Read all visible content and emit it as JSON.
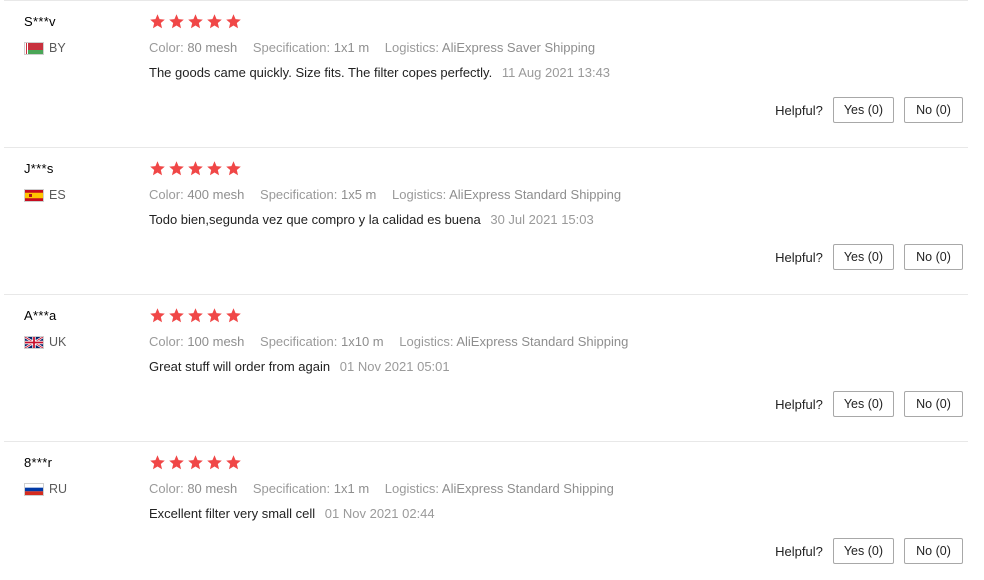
{
  "labels": {
    "color": "Color:",
    "specification": "Specification:",
    "logistics": "Logistics:",
    "helpful": "Helpful?"
  },
  "colors": {
    "star": "#f04747",
    "separator": "#e8e8e8"
  },
  "reviews": [
    {
      "user": "S***v",
      "country": "BY",
      "flag_icon": "belarus-flag-icon",
      "rating": 5,
      "color": "80 mesh",
      "specification": "1x1 m",
      "logistics": "AliExpress Saver Shipping",
      "text": "The goods came quickly. Size fits. The filter copes perfectly.",
      "date": "11 Aug 2021 13:43",
      "yes": "Yes (0)",
      "no": "No (0)"
    },
    {
      "user": "J***s",
      "country": "ES",
      "flag_icon": "spain-flag-icon",
      "rating": 5,
      "color": "400 mesh",
      "specification": "1x5 m",
      "logistics": "AliExpress Standard Shipping",
      "text": "Todo bien,segunda vez que compro y la calidad es buena",
      "date": "30 Jul 2021 15:03",
      "yes": "Yes (0)",
      "no": "No (0)"
    },
    {
      "user": "A***a",
      "country": "UK",
      "flag_icon": "uk-flag-icon",
      "rating": 5,
      "color": "100 mesh",
      "specification": "1x10 m",
      "logistics": "AliExpress Standard Shipping",
      "text": "Great stuff will order from again",
      "date": "01 Nov 2021 05:01",
      "yes": "Yes (0)",
      "no": "No (0)"
    },
    {
      "user": "8***r",
      "country": "RU",
      "flag_icon": "russia-flag-icon",
      "rating": 5,
      "color": "80 mesh",
      "specification": "1x1 m",
      "logistics": "AliExpress Standard Shipping",
      "text": "Excellent filter very small cell",
      "date": "01 Nov 2021 02:44",
      "yes": "Yes (0)",
      "no": "No (0)"
    }
  ]
}
